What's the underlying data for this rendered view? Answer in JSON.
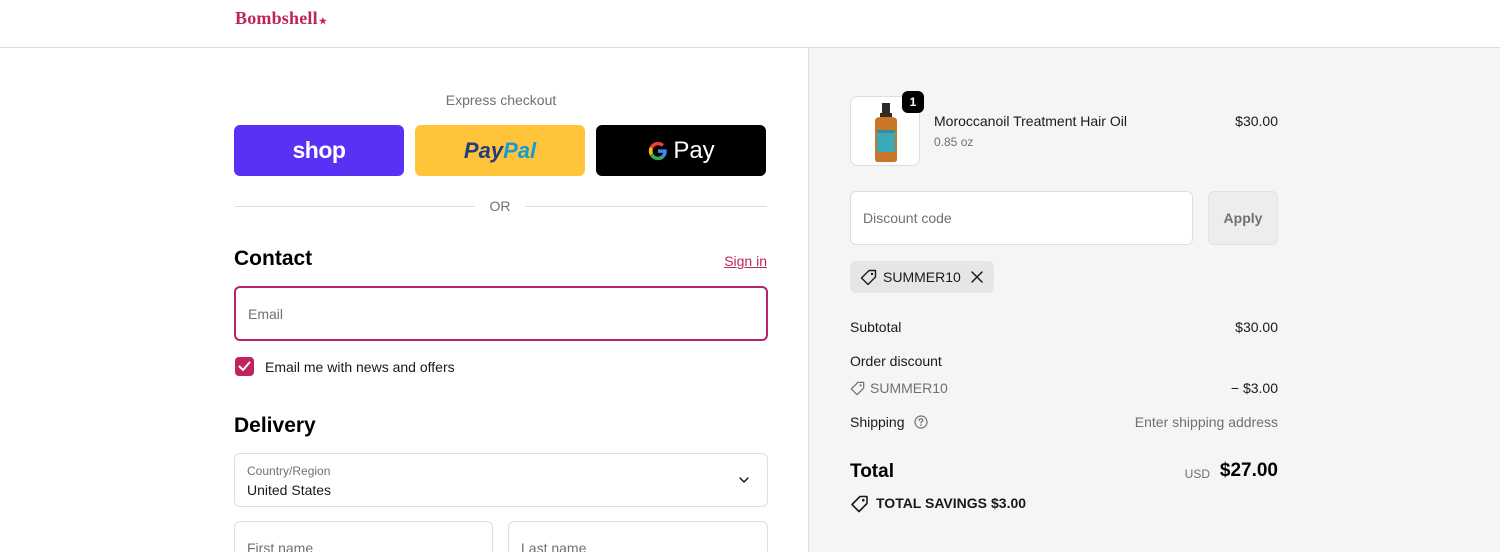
{
  "header": {
    "logo": "Bombshell",
    "logo_mark": "★"
  },
  "express": {
    "label": "Express checkout",
    "shop_label": "shop",
    "paypal_label_1": "Pay",
    "paypal_label_2": "Pal",
    "gpay_g": "G",
    "gpay_label": "Pay",
    "or_text": "OR"
  },
  "contact": {
    "title": "Contact",
    "sign_in": "Sign in",
    "email_placeholder": "Email",
    "newsletter_label": "Email me with news and offers",
    "newsletter_checked": true
  },
  "delivery": {
    "title": "Delivery",
    "country_label": "Country/Region",
    "country_value": "United States",
    "first_name_placeholder": "First name",
    "last_name_placeholder": "Last name"
  },
  "summary": {
    "product": {
      "name": "Moroccanoil Treatment Hair Oil",
      "variant": "0.85 oz",
      "price": "$30.00",
      "quantity": "1"
    },
    "discount_placeholder": "Discount code",
    "apply_label": "Apply",
    "applied_code": "SUMMER10",
    "subtotal_label": "Subtotal",
    "subtotal_value": "$30.00",
    "order_discount_label": "Order discount",
    "discount_code": "SUMMER10",
    "discount_value": "− $3.00",
    "shipping_label": "Shipping",
    "shipping_value": "Enter shipping address",
    "total_label": "Total",
    "total_currency": "USD",
    "total_value": "$27.00",
    "savings_label": "TOTAL SAVINGS",
    "savings_value": "$3.00"
  },
  "colors": {
    "brand": "#c0245f",
    "shop_purple": "#5a31f4",
    "paypal_yellow": "#ffc439",
    "gpay_black": "#000000"
  }
}
